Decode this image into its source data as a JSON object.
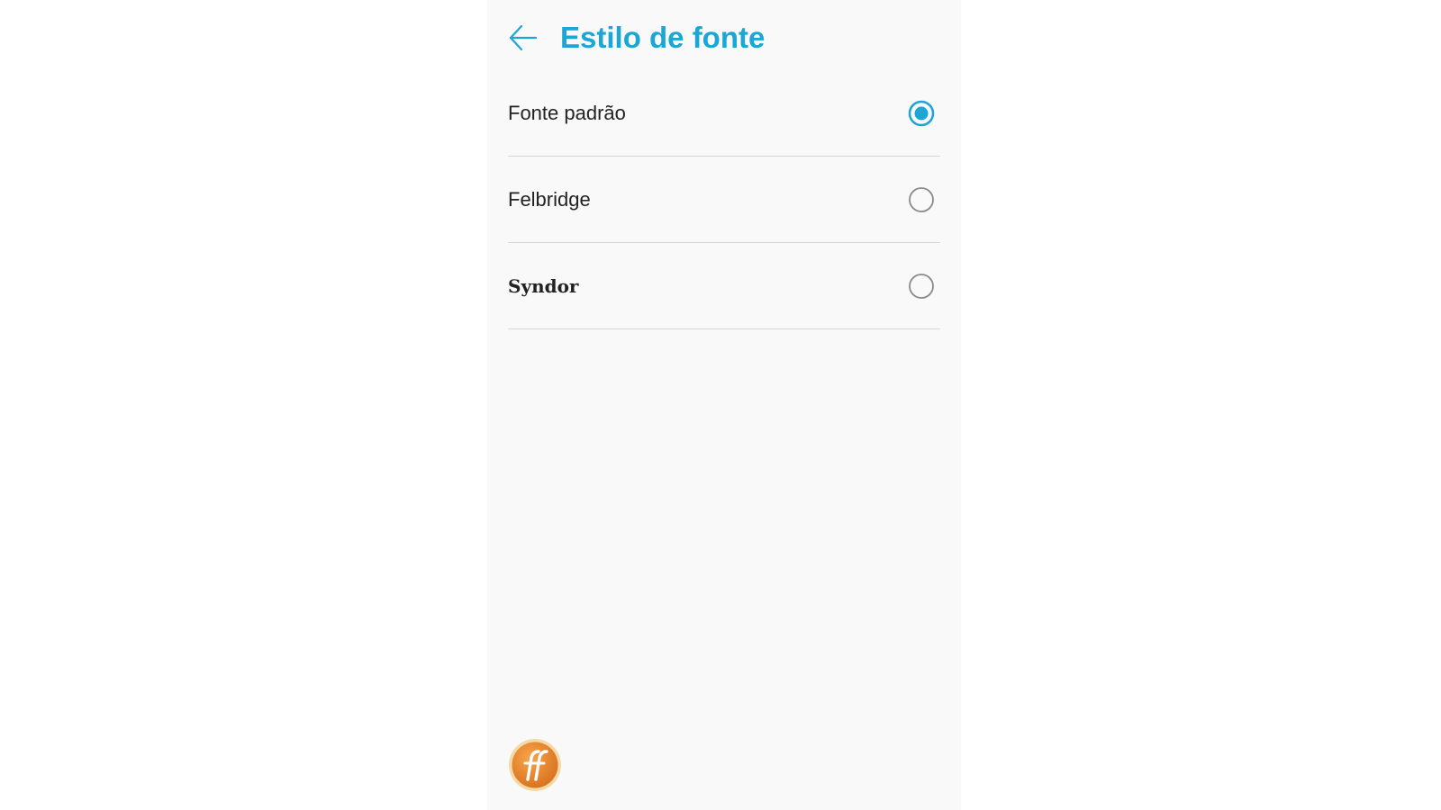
{
  "header": {
    "title": "Estilo de fonte",
    "back_icon": "arrow-left-icon"
  },
  "font_options": [
    {
      "label": "Fonte padrão",
      "selected": true
    },
    {
      "label": "Felbridge",
      "selected": false
    },
    {
      "label": "Syndor",
      "selected": false
    }
  ],
  "watermark": {
    "text": "ff"
  },
  "colors": {
    "accent": "#1ba6d6",
    "background": "#f9f9f9",
    "divider": "#d6d6d6",
    "radio_unselected": "#8a8a8a",
    "logo_orange": "#e8862a",
    "logo_ring": "#f3d9a6"
  }
}
